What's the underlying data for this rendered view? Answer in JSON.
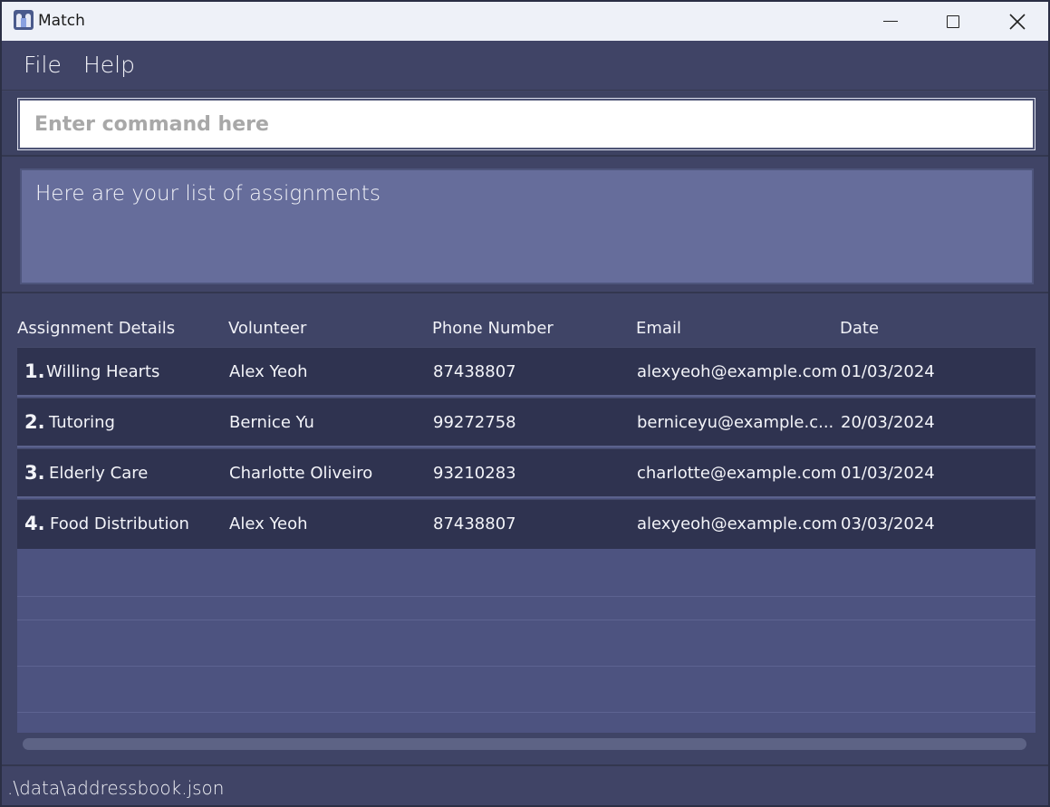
{
  "window": {
    "title": "Match",
    "icon": "match-app-icon"
  },
  "menu": {
    "file": "File",
    "help": "Help"
  },
  "command": {
    "placeholder": "Enter command here",
    "value": ""
  },
  "result": {
    "message": "Here are your list of assignments"
  },
  "table": {
    "headers": [
      "Assignment Details",
      "Volunteer",
      "Phone Number",
      "Email",
      "Date"
    ],
    "rows": [
      {
        "index": "1.",
        "details": "Willing Hearts",
        "volunteer": "Alex Yeoh",
        "phone": "87438807",
        "email": "alexyeoh@example.com",
        "date": "01/03/2024"
      },
      {
        "index": "2.",
        "details": "Tutoring",
        "volunteer": "Bernice Yu",
        "phone": "99272758",
        "email": "berniceyu@example.c...",
        "date": "20/03/2024"
      },
      {
        "index": "3.",
        "details": "Elderly Care",
        "volunteer": "Charlotte Oliveiro",
        "phone": "93210283",
        "email": "charlotte@example.com",
        "date": "01/03/2024"
      },
      {
        "index": "4.",
        "details": "Food Distribution",
        "volunteer": "Alex Yeoh",
        "phone": "87438807",
        "email": "alexyeoh@example.com",
        "date": "03/03/2024"
      }
    ]
  },
  "status": {
    "path": ".\\data\\addressbook.json"
  }
}
